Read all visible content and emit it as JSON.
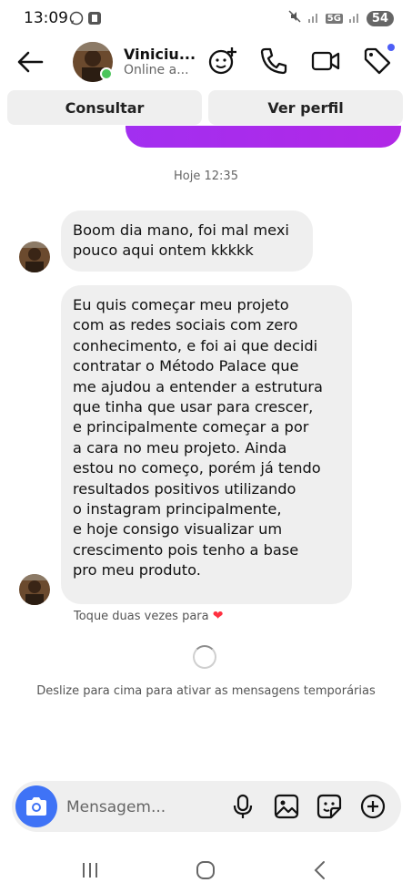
{
  "status_bar": {
    "time": "13:09",
    "network": "5G",
    "battery": "54"
  },
  "header": {
    "contact_name": "Viniciu...",
    "contact_status": "Online a...",
    "icons": [
      "back-arrow-icon",
      "sticker-add-icon",
      "phone-icon",
      "video-icon",
      "tag-icon"
    ],
    "notification_color": "#4d5ef6",
    "online_color": "#4ac55a"
  },
  "actions": {
    "consult_label": "Consultar",
    "profile_label": "Ver perfil"
  },
  "chat": {
    "timestamp": "Hoje 12:35",
    "messages": [
      {
        "text": "Boom dia mano, foi mal mexi\npouco aqui ontem kkkkk"
      },
      {
        "text": "Eu quis começar meu projeto\ncom as redes sociais com zero\nconhecimento, e foi ai que decidi\ncontratar o Método Palace que\nme ajudou a entender a estrutura\nque tinha que usar para crescer,\ne principalmente começar a por\na cara no meu projeto. Ainda\nestou no começo, porém já tendo\nresultados positivos utilizando\no instagram principalmente,\ne hoje consigo visualizar um\ncrescimento pois tenho a base\npro meu produto."
      }
    ],
    "like_hint": "Toque duas vezes para",
    "heart": "❤",
    "swipe_hint": "Deslize para cima para ativar as mensagens temporárias",
    "sent_bubble_color": "#a22ff0"
  },
  "composer": {
    "placeholder": "Mensagem...",
    "camera_color": "#3f73f6",
    "icons": [
      "camera-icon",
      "microphone-icon",
      "gallery-icon",
      "sticker-icon",
      "plus-icon"
    ]
  },
  "nav": {
    "icons": [
      "recent-apps-icon",
      "home-icon",
      "back-icon"
    ]
  }
}
